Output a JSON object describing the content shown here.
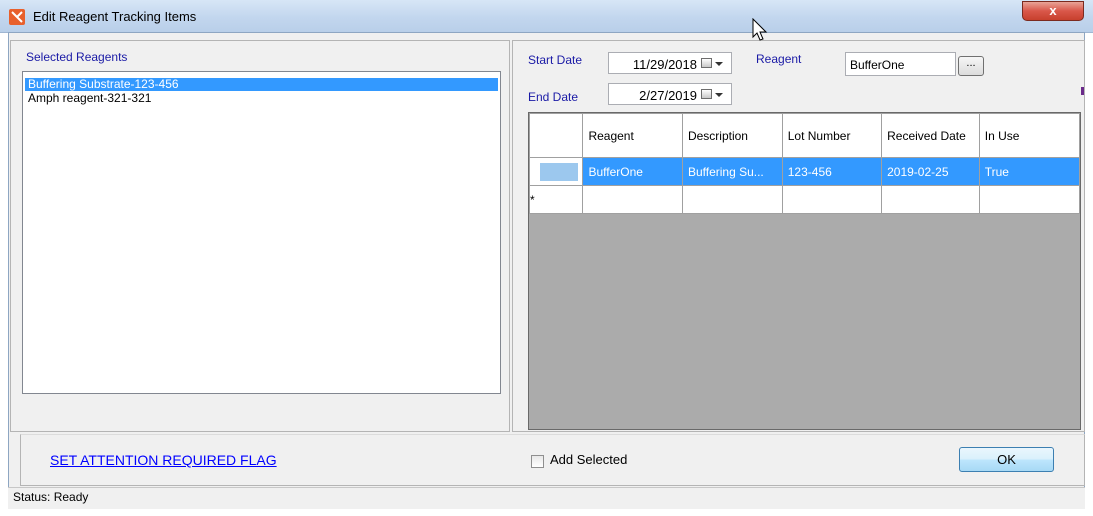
{
  "window": {
    "title": "Edit Reagent Tracking Items",
    "close_label": "x"
  },
  "left": {
    "label": "Selected Reagents",
    "items": [
      "Buffering Substrate-123-456",
      "Amph reagent-321-321"
    ]
  },
  "filters": {
    "start_date_label": "Start Date",
    "start_date": "11/29/2018",
    "end_date_label": "End Date",
    "end_date": "2/27/2019",
    "reagent_label": "Reagent",
    "reagent_value": "BufferOne",
    "browse_label": "..."
  },
  "grid": {
    "columns": [
      "Reagent",
      "Description",
      "Lot Number",
      "Received Date",
      "In Use"
    ],
    "rows": [
      [
        "BufferOne",
        "Buffering Su...",
        "123-456",
        "2019-02-25",
        "True"
      ]
    ],
    "new_row_marker": "*"
  },
  "bottom": {
    "flag_link": "SET ATTENTION REQUIRED FLAG",
    "add_selected_label": "Add Selected",
    "ok_label": "OK"
  },
  "status": {
    "text": "Status: Ready"
  },
  "colors": {
    "selection": "#3399ff",
    "app_icon": "#e8602c",
    "link": "#0000ff"
  }
}
